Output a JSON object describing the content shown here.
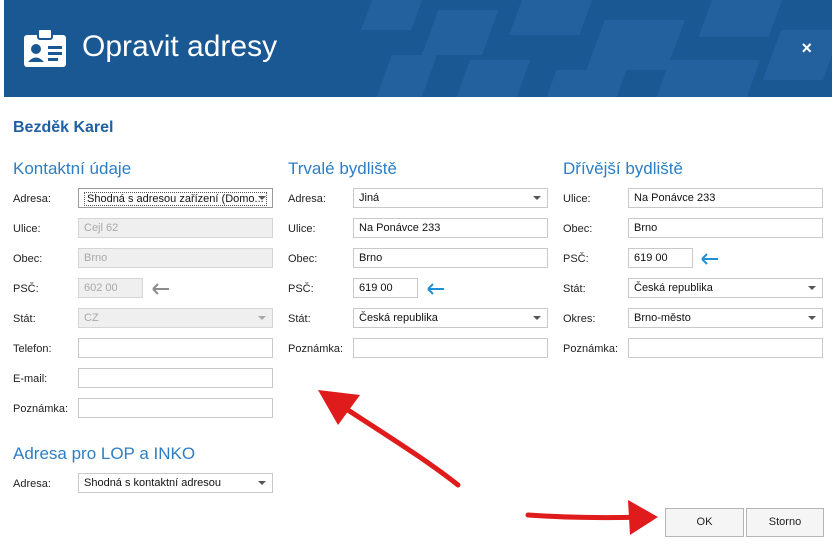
{
  "dialog": {
    "title": "Opravit adresy",
    "close_label": "×"
  },
  "person_name": "Bezděk Karel",
  "contact": {
    "title": "Kontaktní údaje",
    "labels": {
      "adresa": "Adresa:",
      "ulice": "Ulice:",
      "obec": "Obec:",
      "psc": "PSČ:",
      "stat": "Stát:",
      "telefon": "Telefon:",
      "email": "E-mail:",
      "poznamka": "Poznámka:"
    },
    "values": {
      "adresa": "Shodná s adresou zařízení (Domo...",
      "ulice": "Cejl 62",
      "obec": "Brno",
      "psc": "602 00",
      "stat": "CZ",
      "telefon": "",
      "email": "",
      "poznamka": ""
    }
  },
  "permanent": {
    "title": "Trvalé bydliště",
    "labels": {
      "adresa": "Adresa:",
      "ulice": "Ulice:",
      "obec": "Obec:",
      "psc": "PSČ:",
      "stat": "Stát:",
      "poznamka": "Poznámka:"
    },
    "values": {
      "adresa": "Jiná",
      "ulice": "Na Ponávce 233",
      "obec": "Brno",
      "psc": "619 00",
      "stat": "Česká republika",
      "poznamka": ""
    }
  },
  "previous": {
    "title": "Dřívější bydliště",
    "labels": {
      "ulice": "Ulice:",
      "obec": "Obec:",
      "psc": "PSČ:",
      "stat": "Stát:",
      "okres": "Okres:",
      "poznamka": "Poznámka:"
    },
    "values": {
      "ulice": "Na Ponávce 233",
      "obec": "Brno",
      "psc": "619 00",
      "stat": "Česká republika",
      "okres": "Brno-město",
      "poznamka": ""
    }
  },
  "lop": {
    "title": "Adresa pro LOP a INKO",
    "labels": {
      "adresa": "Adresa:"
    },
    "values": {
      "adresa": "Shodná s kontaktní adresou"
    }
  },
  "buttons": {
    "ok": "OK",
    "cancel": "Storno"
  },
  "colors": {
    "header_bg": "#1a5894",
    "section_title": "#2d7ec4",
    "arrow_blue": "#1e90d6",
    "annotation_red": "#e01b1b"
  },
  "icons": {
    "header": "contact-card-icon",
    "copy_arrow": "arrow-left-icon"
  }
}
